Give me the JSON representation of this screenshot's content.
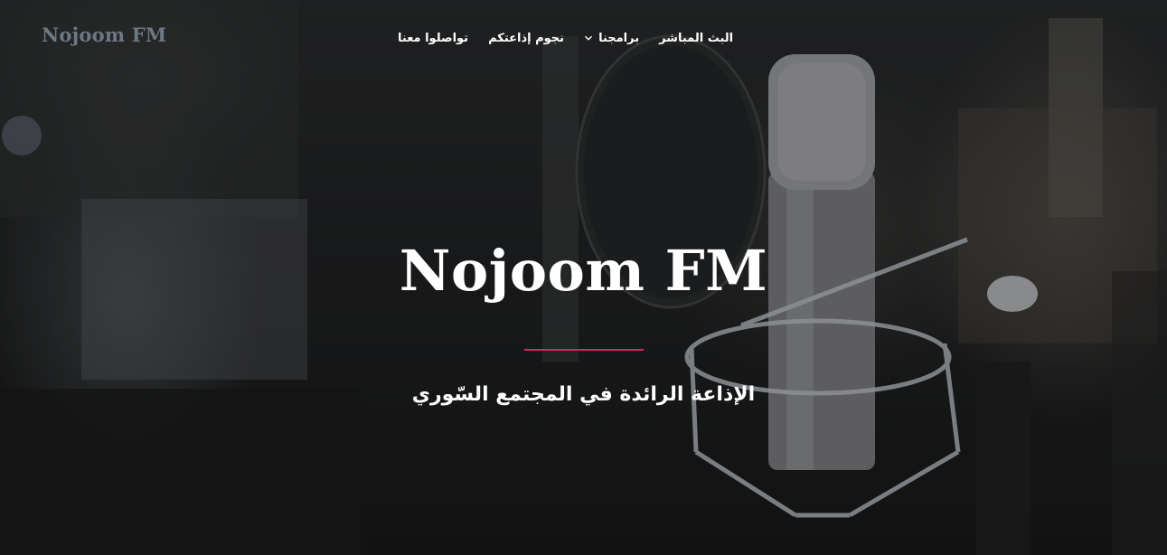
{
  "site": {
    "logo_text": "Nojoom FM"
  },
  "nav": {
    "items": [
      {
        "label": "تواصلوا معنا"
      },
      {
        "label": "نجوم إذاعتكم"
      },
      {
        "label": "برامجنا"
      },
      {
        "label": "البث المباشر"
      }
    ],
    "dropdown_icon": "chevron-down-icon"
  },
  "hero": {
    "title": "Nojoom FM",
    "subtitle": "الإذاعة الرائدة في المجتمع السّوري",
    "accent_color": "#d3285f",
    "background_image": "studio-microphone-photo"
  }
}
